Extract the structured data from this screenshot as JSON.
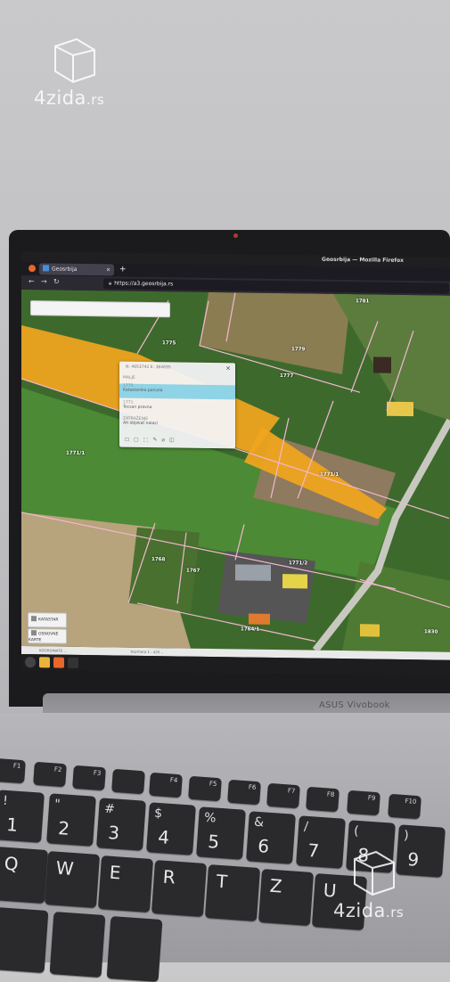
{
  "watermark": {
    "brand": "4zida",
    "tld": ".rs"
  },
  "browser": {
    "window_title": "Geosrbija — Mozilla Firefox",
    "tab_title": "Geosrbija",
    "tab_close": "×",
    "new_tab": "+",
    "url": "https://a3.geosrbija.rs"
  },
  "map": {
    "parcel_labels": [
      "1781",
      "1775",
      "1779",
      "1777",
      "1771/1",
      "1771/2",
      "1768",
      "1767",
      "1773/2",
      "1830",
      "1764/1"
    ],
    "popup": {
      "header": "N: 4953742 E: 384695",
      "close": "×",
      "rows": [
        {
          "a": "MALJE",
          "b": ""
        },
        {
          "a": "1775",
          "b": "Katastarska parcela"
        },
        {
          "a": "1771",
          "b": "Tecsan pravna"
        },
        {
          "a": "ZATRAŽENJE",
          "b": "Alt objekat nalazi"
        }
      ]
    },
    "side_buttons": [
      "KATASTAR",
      "OSNOVNE KARTE"
    ]
  },
  "statusbar": {
    "left": "KOORDINATE ...",
    "right": "Razmera 1 : 425 .."
  },
  "laptop": {
    "brand": "ASUS Vivobook"
  },
  "keyboard": {
    "fn_row": [
      "F1",
      "F2",
      "F3",
      "F4",
      "F5",
      "F6",
      "F7",
      "F8",
      "F9",
      "F10"
    ],
    "num_row": [
      {
        "top": "!",
        "bottom": "1"
      },
      {
        "top": "\"",
        "bottom": "2"
      },
      {
        "top": "#",
        "bottom": "3"
      },
      {
        "top": "$",
        "bottom": "4"
      },
      {
        "top": "%",
        "bottom": "5"
      },
      {
        "top": "&",
        "bottom": "6"
      },
      {
        "top": "/",
        "bottom": "7"
      },
      {
        "top": "(",
        "bottom": "8"
      },
      {
        "top": ")",
        "bottom": "9"
      }
    ],
    "letter_row": [
      "Q",
      "W",
      "E",
      "R",
      "T",
      "Z",
      "U"
    ]
  }
}
